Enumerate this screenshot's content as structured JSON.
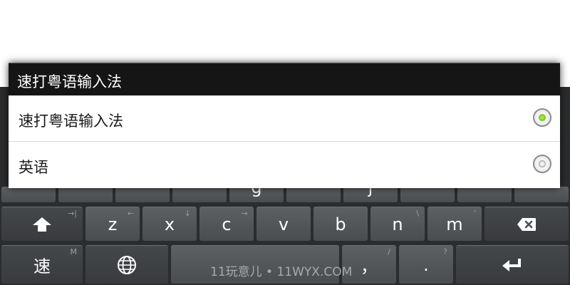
{
  "dialog": {
    "title": "速打粤语输入法",
    "options": [
      {
        "label": "速打粤语输入法",
        "selected": true
      },
      {
        "label": "英语",
        "selected": false
      }
    ]
  },
  "keyboard": {
    "row1_visible_fragments": [
      "g",
      "j"
    ],
    "row2": {
      "shift_hint": "→|",
      "keys": [
        {
          "label": "z",
          "hint": "←"
        },
        {
          "label": "x",
          "hint": "↓"
        },
        {
          "label": "c",
          "hint": "→"
        },
        {
          "label": "v",
          "hint": ""
        },
        {
          "label": "b",
          "hint": ""
        },
        {
          "label": "n",
          "hint": "\\"
        },
        {
          "label": "m",
          "hint": "'"
        }
      ]
    },
    "row3": {
      "mode_key": {
        "label": "速",
        "hint": "M"
      },
      "comma_key": {
        "label": "，",
        "hint": "/"
      },
      "period_key": {
        "label": ".",
        "hint": "?"
      }
    }
  },
  "watermark": "11玩意儿 • 11WYX.COM",
  "colors": {
    "accent_green": "#52b100",
    "keyboard_bg": "#2b2c2e",
    "title_bar": "#151515"
  }
}
